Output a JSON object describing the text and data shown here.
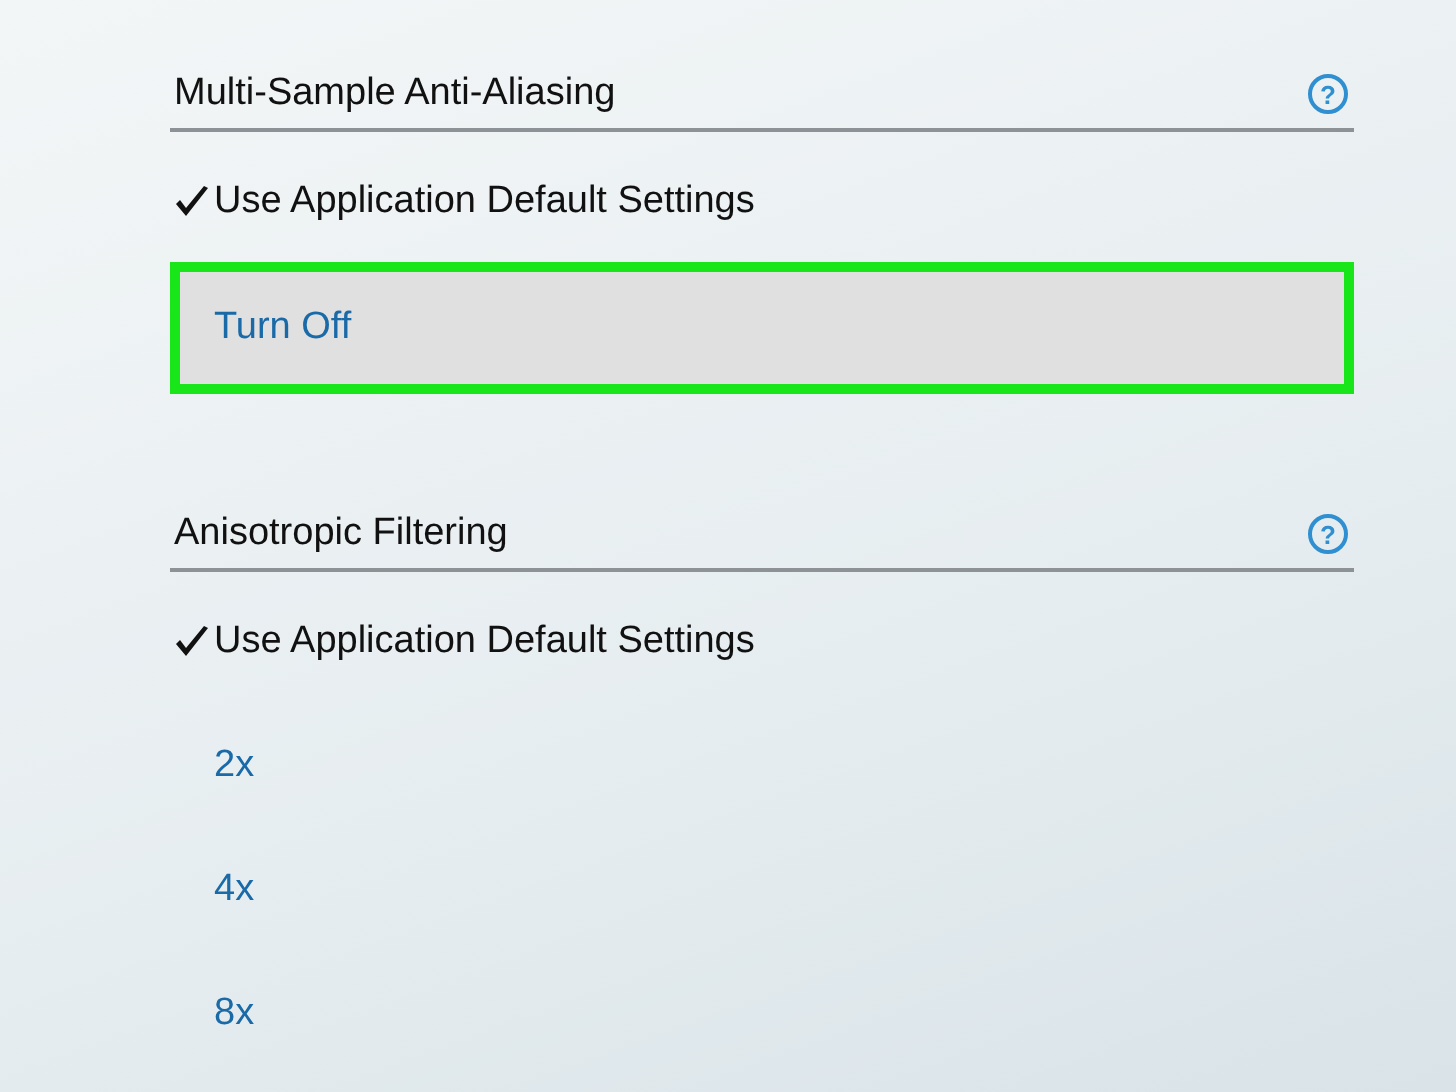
{
  "sections": [
    {
      "title": "Multi-Sample Anti-Aliasing",
      "help": "?",
      "options": [
        {
          "label": "Use Application Default Settings",
          "selected": true,
          "highlighted": false
        },
        {
          "label": "Turn Off",
          "selected": false,
          "highlighted": true
        }
      ]
    },
    {
      "title": "Anisotropic Filtering",
      "help": "?",
      "options": [
        {
          "label": "Use Application Default Settings",
          "selected": true,
          "highlighted": false
        },
        {
          "label": "2x",
          "selected": false,
          "highlighted": false
        },
        {
          "label": "4x",
          "selected": false,
          "highlighted": false
        },
        {
          "label": "8x",
          "selected": false,
          "highlighted": false
        }
      ]
    }
  ]
}
